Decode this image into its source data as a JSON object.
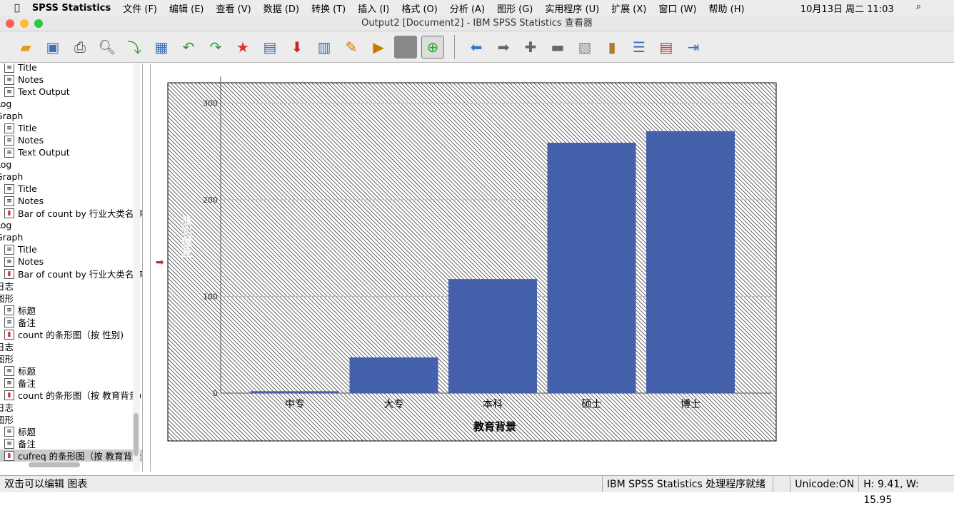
{
  "menubar": {
    "app": "SPSS Statistics",
    "items": [
      "文件 (F)",
      "编辑 (E)",
      "查看 (V)",
      "数据 (D)",
      "转换 (T)",
      "插入 (I)",
      "格式 (O)",
      "分析 (A)",
      "图形 (G)",
      "实用程序 (U)",
      "扩展 (X)",
      "窗口 (W)",
      "帮助 (H)"
    ],
    "clock": "10月13日 周二  11:03"
  },
  "window": {
    "title": "Output2 [Document2] - IBM SPSS Statistics 查看器"
  },
  "tree": [
    {
      "label": "Title",
      "icon": "doc"
    },
    {
      "label": "Notes",
      "icon": "doc"
    },
    {
      "label": "Text Output",
      "icon": "doc"
    },
    {
      "label": "Log",
      "icon": "none"
    },
    {
      "label": "Graph",
      "icon": "none"
    },
    {
      "label": "Title",
      "icon": "doc"
    },
    {
      "label": "Notes",
      "icon": "doc"
    },
    {
      "label": "Text Output",
      "icon": "doc"
    },
    {
      "label": "Log",
      "icon": "none"
    },
    {
      "label": "Graph",
      "icon": "none"
    },
    {
      "label": "Title",
      "icon": "doc"
    },
    {
      "label": "Notes",
      "icon": "doc"
    },
    {
      "label": "Bar of count by 行业大类名称",
      "icon": "chart"
    },
    {
      "label": "Log",
      "icon": "none"
    },
    {
      "label": "Graph",
      "icon": "none"
    },
    {
      "label": "Title",
      "icon": "doc"
    },
    {
      "label": "Notes",
      "icon": "doc"
    },
    {
      "label": "Bar of count by 行业大类名称",
      "icon": "chart"
    },
    {
      "label": "日志",
      "icon": "none"
    },
    {
      "label": "图形",
      "icon": "none"
    },
    {
      "label": "标题",
      "icon": "doc"
    },
    {
      "label": "备注",
      "icon": "doc"
    },
    {
      "label": "count 的条形图（按 性别)",
      "icon": "chart"
    },
    {
      "label": "日志",
      "icon": "none"
    },
    {
      "label": "图形",
      "icon": "none"
    },
    {
      "label": "标题",
      "icon": "doc"
    },
    {
      "label": "备注",
      "icon": "doc"
    },
    {
      "label": "count 的条形图（按 教育背景)",
      "icon": "chart"
    },
    {
      "label": "日志",
      "icon": "none"
    },
    {
      "label": "图形",
      "icon": "none"
    },
    {
      "label": "标题",
      "icon": "doc"
    },
    {
      "label": "备注",
      "icon": "doc"
    },
    {
      "label": "cufreq 的条形图（按 教育背景)",
      "icon": "chart",
      "selected": true
    }
  ],
  "status": {
    "hint": "双击可以编辑 图表",
    "processor": "IBM SPSS Statistics 处理程序就绪",
    "unicode": "Unicode:ON",
    "size": "H: 9.41, W: 15.95"
  },
  "chart_data": {
    "type": "bar",
    "categories": [
      "中专",
      "大专",
      "本科",
      "硕士",
      "博士"
    ],
    "values": [
      2,
      37,
      118,
      259,
      271
    ],
    "xlabel": "教育背景",
    "ylabel": "累积频率",
    "ylim": [
      0,
      320
    ],
    "yticks": [
      0,
      100,
      200,
      300
    ],
    "bar_color": "#4a66b0",
    "grid": true
  }
}
